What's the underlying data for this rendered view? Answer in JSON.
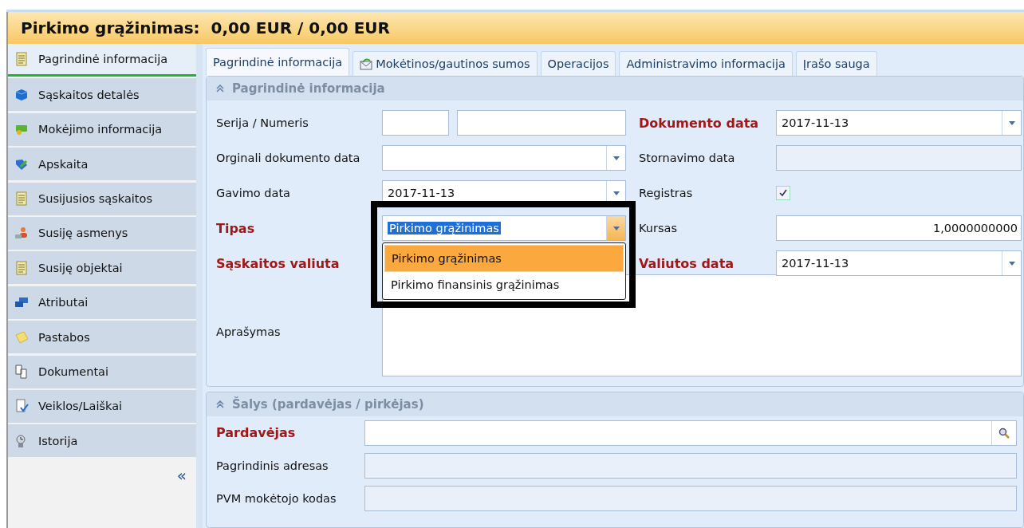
{
  "title": "Pirkimo grąžinimas:  0,00 EUR / 0,00 EUR",
  "sidebar": {
    "items": [
      {
        "label": "Pagrindinė informacija",
        "selected": true
      },
      {
        "label": "Sąskaitos detalės",
        "selected": false
      },
      {
        "label": "Mokėjimo informacija",
        "selected": false
      },
      {
        "label": "Apskaita",
        "selected": false
      },
      {
        "label": "Susijusios sąskaitos",
        "selected": false
      },
      {
        "label": "Susiję asmenys",
        "selected": false
      },
      {
        "label": "Susiję objektai",
        "selected": false
      },
      {
        "label": "Atributai",
        "selected": false
      },
      {
        "label": "Pastabos",
        "selected": false
      },
      {
        "label": "Dokumentai",
        "selected": false
      },
      {
        "label": "Veiklos/Laiškai",
        "selected": false
      },
      {
        "label": "Istorija",
        "selected": false
      }
    ],
    "collapse": "«"
  },
  "tabs": [
    {
      "label": "Pagrindinė informacija",
      "selected": true
    },
    {
      "label": "Mokėtinos/gautinos sumos",
      "selected": false
    },
    {
      "label": "Operacijos",
      "selected": false
    },
    {
      "label": "Administravimo informacija",
      "selected": false
    },
    {
      "label": "Įrašo sauga",
      "selected": false
    }
  ],
  "main_section": {
    "title": "Pagrindinė informacija",
    "left": [
      {
        "label": "Serija / Numeris",
        "required": false,
        "kind": "pair"
      },
      {
        "label": "Orginali dokumento data",
        "required": false,
        "kind": "combo"
      },
      {
        "label": "Gavimo data",
        "required": false,
        "kind": "combo",
        "value": "2017-11-13"
      },
      {
        "label": "Tipas",
        "required": true,
        "kind": "combo",
        "value": "Pirkimo grąžinimas",
        "open": true
      },
      {
        "label": "Sąskaitos valiuta",
        "required": true,
        "kind": "covered"
      },
      {
        "label": "Aprašymas",
        "required": false,
        "kind": "memo"
      }
    ],
    "right": [
      {
        "label": "Dokumento data",
        "required": true,
        "kind": "combo",
        "value": "2017-11-13"
      },
      {
        "label": "Stornavimo data",
        "required": false,
        "kind": "readonly"
      },
      {
        "label": "Registras",
        "required": false,
        "kind": "checkbox",
        "checked": true
      },
      {
        "label": "Kursas",
        "required": false,
        "kind": "number",
        "value": "1,0000000000"
      },
      {
        "label": "Valiutos data",
        "required": true,
        "kind": "combo",
        "value": "2017-11-13"
      }
    ],
    "dropdown": [
      {
        "label": "Pirkimo grąžinimas",
        "selected": true
      },
      {
        "label": "Pirkimo finansinis grąžinimas",
        "selected": false
      }
    ]
  },
  "parties_section": {
    "title": "Šalys (pardavėjas / pirkėjas)",
    "rows": [
      {
        "label": "Pardavėjas",
        "required": true,
        "kind": "search"
      },
      {
        "label": "Pagrindinis adresas",
        "required": false,
        "kind": "readonly"
      },
      {
        "label": "PVM mokėtojo kodas",
        "required": false,
        "kind": "readonly"
      }
    ]
  }
}
